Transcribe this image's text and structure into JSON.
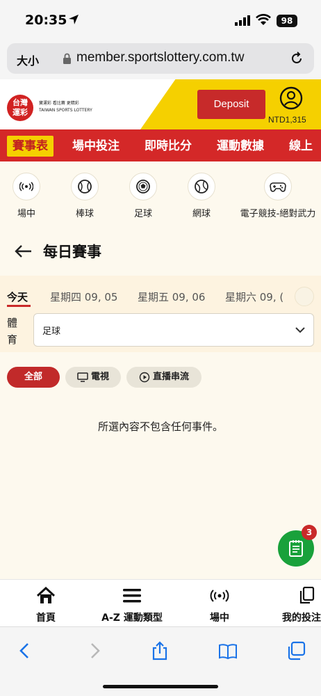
{
  "status": {
    "time": "20:35",
    "battery": "98"
  },
  "browser": {
    "text_size": "大小",
    "url": "member.sportslottery.com.tw"
  },
  "header": {
    "logo_text": "台灣\n運彩",
    "logo_sub": "寶運彩  看比賽  更精彩\nTAIWAN SPORTS LOTTERY",
    "deposit_label": "Deposit",
    "balance": "NTD1,315",
    "brand_color": "#d42828",
    "accent_color": "#f5d000"
  },
  "nav": {
    "items": [
      "賽事表",
      "場中投注",
      "即時比分",
      "運動數據",
      "線上"
    ]
  },
  "sports": [
    {
      "label": "場中",
      "icon": "live-icon"
    },
    {
      "label": "棒球",
      "icon": "baseball-icon"
    },
    {
      "label": "足球",
      "icon": "soccer-icon"
    },
    {
      "label": "網球",
      "icon": "tennis-icon"
    },
    {
      "label": "電子競技-絕對武力",
      "icon": "gamepad-icon"
    }
  ],
  "page": {
    "title": "每日賽事"
  },
  "date_tabs": [
    "今天",
    "星期四 09, 05",
    "星期五 09, 06",
    "星期六 09, ("
  ],
  "sport_filter": {
    "label": "體\n育",
    "selected": "足球"
  },
  "filters": {
    "all": "全部",
    "tv": "電視",
    "stream": "直播串流"
  },
  "empty_message": "所選內容不包含任何事件。",
  "betslip": {
    "count": "3"
  },
  "bottom_nav": {
    "home": "首頁",
    "az": "A-Z 運動類型",
    "live": "場中",
    "mybets": "我的投注"
  }
}
